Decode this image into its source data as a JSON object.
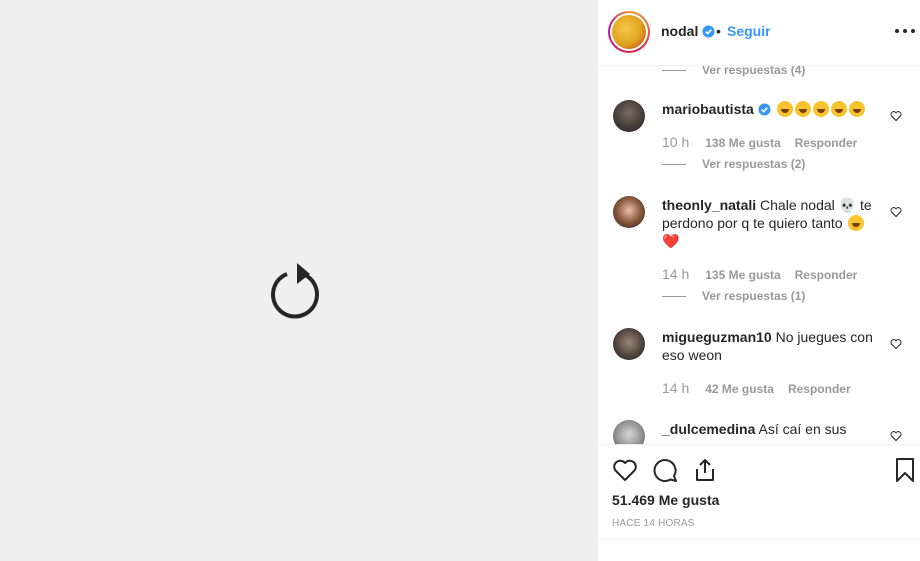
{
  "post": {
    "username": "nodal",
    "follow_label": "Seguir",
    "separator": "•"
  },
  "comments": [
    {
      "replies_label": "Ver respuestas (4)"
    },
    {
      "username": "mariobautista",
      "text": "",
      "emoji_count": 5,
      "time": "10 h",
      "likes": "138 Me gusta",
      "reply_label": "Responder",
      "replies_label": "Ver respuestas (2)"
    },
    {
      "username": "theonly_natali",
      "text_line1": "Chale nodal 💀 te",
      "text_line2": "perdono por q te quiero tanto",
      "text_line3": "❤️",
      "time": "14 h",
      "likes": "135 Me gusta",
      "reply_label": "Responder",
      "replies_label": "Ver respuestas (1)"
    },
    {
      "username": "migueguzman10",
      "text_line1": "No juegues con",
      "text_line2": "eso weon",
      "time": "14 h",
      "likes": "42 Me gusta",
      "reply_label": "Responder"
    },
    {
      "username": "_dulcemedina",
      "text_line1": "Así caí en sus"
    }
  ],
  "footer": {
    "likes_count": "51.469 Me gusta",
    "time_ago": "HACE 14 HORAS"
  },
  "icons": {
    "reload": "reload-icon",
    "verified": "verified-badge-icon",
    "more": "more-options-icon",
    "like": "heart-icon",
    "comment": "comment-icon",
    "share": "share-icon",
    "save": "bookmark-icon"
  },
  "colors": {
    "accent": "#3897f0",
    "muted": "#999999",
    "text": "#262626",
    "media_bg": "#efefef"
  }
}
